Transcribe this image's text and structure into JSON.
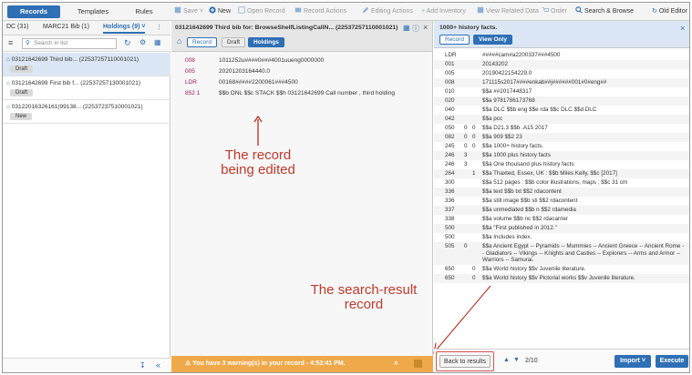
{
  "topbar": {
    "tabs": [
      "Records",
      "Templates",
      "Rules"
    ],
    "actions": [
      {
        "icon": "save-icon",
        "label": "Save ˅",
        "enabled": false
      },
      {
        "icon": "new-icon",
        "label": "New",
        "enabled": true
      },
      {
        "icon": "open-record-icon",
        "label": "Open Record",
        "enabled": false
      },
      {
        "icon": "record-actions-icon",
        "label": "Record Actions",
        "enabled": false
      },
      {
        "icon": "pencil-icon",
        "label": "Editing Actions",
        "enabled": false
      },
      {
        "icon": "plus-icon",
        "label": "Add Inventory",
        "enabled": false
      },
      {
        "icon": "related-data-icon",
        "label": "View Related Data",
        "enabled": false
      },
      {
        "icon": "cart-icon",
        "label": "Order",
        "enabled": false
      },
      {
        "icon": "search-icon",
        "label": "Search & Browse",
        "enabled": true
      }
    ],
    "old_editor": "Old Editor"
  },
  "left": {
    "tabs": [
      "DC (31)",
      "MARC21 Bib (1)",
      "Holdings (9) ˅"
    ],
    "search_placeholder": "Search in list",
    "records": [
      {
        "title": "03121642699 Third bib... (22537257110001021)",
        "status": "Draft"
      },
      {
        "title": "03121642699 First bib f... (22537257130001021)",
        "status": "Draft"
      },
      {
        "title": "03122016326161(99138... (22537237510001021)",
        "status": "New"
      }
    ]
  },
  "middle": {
    "title": "03121642699 Third bib for: BrowseShelfListingCallN...  (22537257110001021)",
    "pills": [
      "Record",
      "Draft",
      "Holdings"
    ],
    "rows": [
      {
        "tag": "008",
        "val": "1011252u####0###4001uueng0000000"
      },
      {
        "tag": "005",
        "val": "20201203164440.0"
      },
      {
        "tag": "LDR",
        "val": "00168#####2200061###4500"
      },
      {
        "tag": "852 1",
        "val": "$$b ONL $$c STACK $$h 03121642699 Call number , third holding"
      }
    ],
    "annotation": "The record being edited",
    "warning": "You have 3 warning(s) in your record - 4:53:41 PM."
  },
  "right": {
    "title": "1000+ history facts.",
    "pills": [
      "Record",
      "View Only"
    ],
    "rows": [
      {
        "tag": "LDR",
        "i1": "",
        "i2": "",
        "val": "#####cam#a2200337###4500"
      },
      {
        "tag": "001",
        "i1": "",
        "i2": "",
        "val": "20143202"
      },
      {
        "tag": "005",
        "i1": "",
        "i2": "",
        "val": "20190422154229.0"
      },
      {
        "tag": "008",
        "i1": "",
        "i2": "",
        "val": "171115s2017####enkab##j######001#0#eng##"
      },
      {
        "tag": "010",
        "i1": "",
        "i2": "",
        "val": "$$a ##2017448317"
      },
      {
        "tag": "020",
        "i1": "",
        "i2": "",
        "val": "$$a 9781786173768"
      },
      {
        "tag": "040",
        "i1": "",
        "i2": "",
        "val": "$$a DLC $$b eng $$e rda $$c DLC $$d DLC"
      },
      {
        "tag": "042",
        "i1": "",
        "i2": "",
        "val": "$$a pcc"
      },
      {
        "tag": "050",
        "i1": "0",
        "i2": "0",
        "val": "$$a D21.3 $$b .A15 2017"
      },
      {
        "tag": "082",
        "i1": "0",
        "i2": "0",
        "val": "$$a 909 $$2 23"
      },
      {
        "tag": "245",
        "i1": "0",
        "i2": "0",
        "val": "$$a 1000+ history facts."
      },
      {
        "tag": "246",
        "i1": "3",
        "i2": "",
        "val": "$$a 1000 plus history facts"
      },
      {
        "tag": "246",
        "i1": "3",
        "i2": "",
        "val": "$$a One thousand plus history facts"
      },
      {
        "tag": "264",
        "i1": "",
        "i2": "1",
        "val": "$$a Thaxted, Essex, UK : $$b Miles Kelly, $$c [2017]"
      },
      {
        "tag": "300",
        "i1": "",
        "i2": "",
        "val": "$$a 512 pages : $$b color illustrations, maps ; $$c 31 cm"
      },
      {
        "tag": "336",
        "i1": "",
        "i2": "",
        "val": "$$a text $$b txt $$2 rdacontent"
      },
      {
        "tag": "336",
        "i1": "",
        "i2": "",
        "val": "$$a still image $$b sti $$2 rdacontent"
      },
      {
        "tag": "337",
        "i1": "",
        "i2": "",
        "val": "$$a unmediated $$b n $$2 rdamedia"
      },
      {
        "tag": "338",
        "i1": "",
        "i2": "",
        "val": "$$a volume $$b nc $$2 rdacarrier"
      },
      {
        "tag": "500",
        "i1": "",
        "i2": "",
        "val": "$$a \"First published in 2012.\""
      },
      {
        "tag": "500",
        "i1": "",
        "i2": "",
        "val": "$$a Includes index."
      },
      {
        "tag": "505",
        "i1": "0",
        "i2": "",
        "val": "$$a Ancient Egypt -- Pyramids -- Mummies -- Ancient Greece -- Ancient Rome -- Gladiators -- Vikings -- Knights and Castles -- Explorers -- Arms and Armor -- Warriors -- Samurai."
      },
      {
        "tag": "650",
        "i1": "",
        "i2": "0",
        "val": "$$a World history $$v Juvenile literature."
      },
      {
        "tag": "650",
        "i1": "",
        "i2": "0",
        "val": "$$a World history $$v Pictorial works $$v Juvenile literature."
      }
    ],
    "annotation": "The search-result record",
    "back": "Back to results",
    "pager": "2/10",
    "import": "Import ˅",
    "execute": "Execute"
  },
  "colors": {
    "accent": "#2f6fb5",
    "annotation": "#c0392b",
    "warning": "#f0a94a",
    "tag": "#a0185a"
  }
}
